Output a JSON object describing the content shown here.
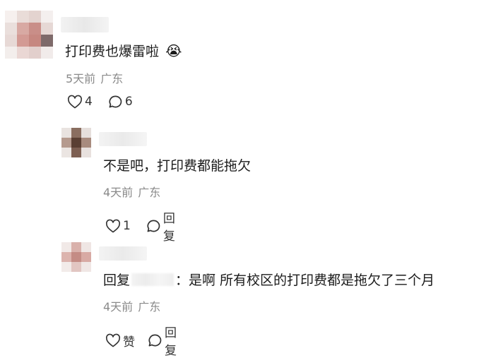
{
  "comments": [
    {
      "text": "打印费也爆雷啦",
      "emoji": "😭",
      "time": "5天前",
      "location": "广东",
      "like_count": "4",
      "reply_count": "6"
    },
    {
      "text": "不是吧，打印费都能拖欠",
      "time": "4天前",
      "location": "广东",
      "like_count": "1",
      "reply_label": "回复"
    },
    {
      "reply_prefix": "回复",
      "text": "：是啊 所有校区的打印费都是拖欠了三个月",
      "time": "4天前",
      "location": "广东",
      "like_label": "赞",
      "reply_label": "回复"
    }
  ],
  "colors": {
    "text": "#1a1a1a",
    "meta": "#8a8a8a",
    "icon": "#333333"
  },
  "icons": [
    "heart-icon",
    "comment-bubble-icon"
  ]
}
